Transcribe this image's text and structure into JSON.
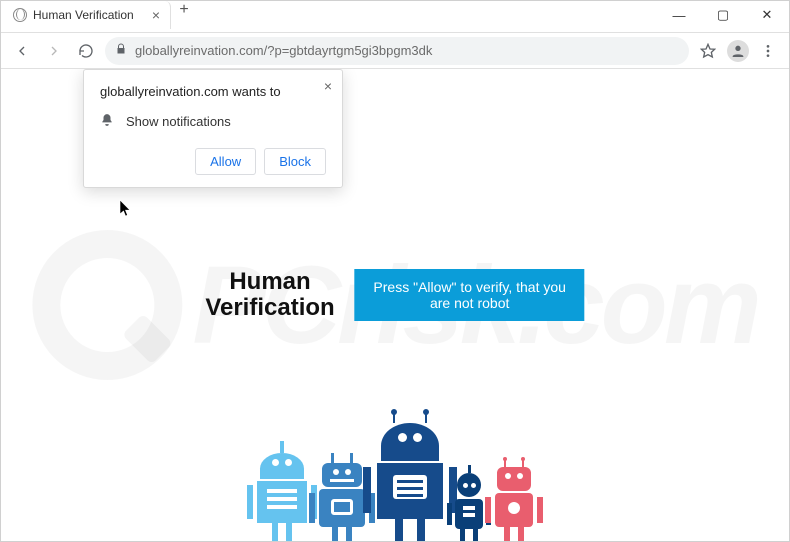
{
  "tab": {
    "title": "Human Verification"
  },
  "address": {
    "url": "globallyreinvation.com/?p=gbtdayrtgm5gi3bpgm3dk"
  },
  "popup": {
    "title": "globallyreinvation.com wants to",
    "row": "Show notifications",
    "allow": "Allow",
    "block": "Block"
  },
  "hero": {
    "line1": "Human",
    "line2": "Verification",
    "banner": "Press \"Allow\" to verify, that you are not robot"
  },
  "watermark": "PCrisk.com",
  "colors": {
    "robot1": "#65c3ef",
    "robot2": "#3a83c1",
    "robot3": "#164b8b",
    "robot4": "#0a3f78",
    "robot5": "#e95e6e"
  }
}
